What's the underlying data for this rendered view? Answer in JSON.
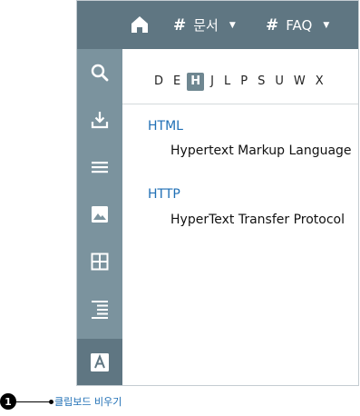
{
  "topbar": {
    "nav": [
      {
        "label": "문서",
        "icon": "hash-icon"
      },
      {
        "label": "FAQ",
        "icon": "hash-icon"
      }
    ]
  },
  "sidebar": {
    "buttons": [
      "search-icon",
      "download-icon",
      "list-icon",
      "image-icon",
      "grid-icon",
      "align-right-icon",
      "font-icon"
    ],
    "active": "font-icon"
  },
  "alphabet": {
    "letters": [
      "D",
      "E",
      "H",
      "J",
      "L",
      "P",
      "S",
      "U",
      "W",
      "X"
    ],
    "active": "H"
  },
  "entries": [
    {
      "term": "HTML",
      "definition": "Hypertext Markup Language"
    },
    {
      "term": "HTTP",
      "definition": "HyperText Transfer Protocol"
    }
  ],
  "callout": {
    "number": "1",
    "label": "클립보드 비우기"
  },
  "colors": {
    "topbar": "#5f7682",
    "sidebar": "#7b939e",
    "link": "#1f6fb5"
  }
}
